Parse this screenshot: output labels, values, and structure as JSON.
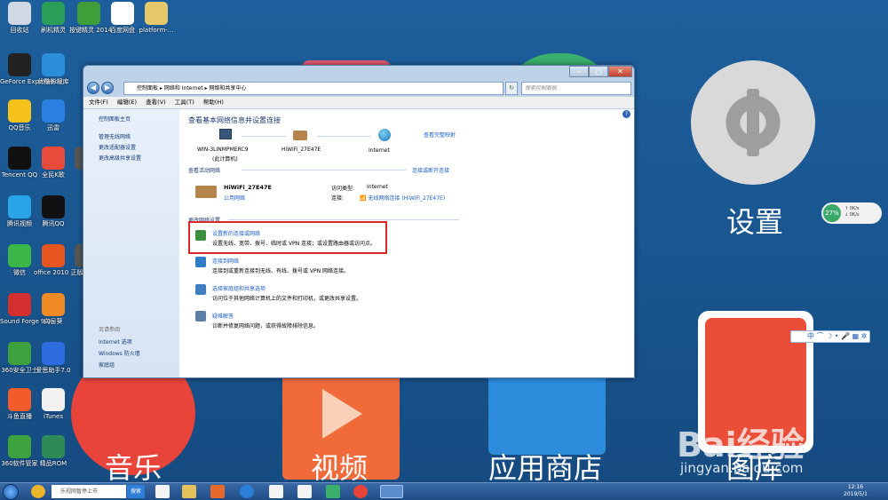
{
  "desktop": {
    "icons": [
      {
        "label": "回收站",
        "color": "#cfd8e3"
      },
      {
        "label": "刷机精灵",
        "color": "#2a9d59"
      },
      {
        "label": "按键精灵 2014",
        "color": "#3f9e3a"
      },
      {
        "label": "百度网盘",
        "color": "#ffffff"
      },
      {
        "label": "platform-...",
        "color": "#e6c86a"
      },
      {
        "label": "GeForce Experience",
        "color": "#222222"
      },
      {
        "label": "优酷影视库",
        "color": "#2a8ed8"
      },
      {
        "label": "QQ音乐",
        "color": "#f4c21b"
      },
      {
        "label": "迅雷",
        "color": "#2b7fe0"
      },
      {
        "label": "Tencent QQ",
        "color": "#111111"
      },
      {
        "label": "全民K歌",
        "color": "#e84b3c"
      },
      {
        "label": "ad",
        "color": "#555555"
      },
      {
        "label": "腾讯视频",
        "color": "#29a4e8"
      },
      {
        "label": "腾讯QQ",
        "color": "#111111"
      },
      {
        "label": "微信",
        "color": "#3bb749"
      },
      {
        "label": "office 2010 正版验证工",
        "color": "#e8561f"
      },
      {
        "label": "23-",
        "color": "#555555"
      },
      {
        "label": "Sound Forge 9.0a",
        "color": "#d43030"
      },
      {
        "label": "向日葵",
        "color": "#f08a24"
      },
      {
        "label": "360安全卫士",
        "color": "#3da23e"
      },
      {
        "label": "爱思助手7.0",
        "color": "#2e6de0"
      },
      {
        "label": "斗鱼直播",
        "color": "#f25b2a"
      },
      {
        "label": "iTunes",
        "color": "#f2f2f2"
      },
      {
        "label": "360软件管家",
        "color": "#3da23e"
      },
      {
        "label": "精品ROM",
        "color": "#2e8b57"
      }
    ],
    "tiles": {
      "settings_label": "设置",
      "music_label": "音乐",
      "video_label": "视频",
      "appstore_label": "应用商店",
      "gallery_label": "图库"
    },
    "net_widget": {
      "percent": "27%",
      "up": "0K/s",
      "down": "0K/s"
    },
    "ime_bar": {
      "text": "中 ⌒ ☽ • 🎤 ▦ ✲"
    },
    "watermark": {
      "logo": "Bai经验",
      "url": "jingyan.baidu.com"
    }
  },
  "window": {
    "nav": {
      "back": "◀",
      "forward": "▶"
    },
    "address": [
      "控制面板",
      "网络和 Internet",
      "网络和共享中心"
    ],
    "address_separator": " ▸ ",
    "refresh": "↻",
    "search_placeholder": "搜索控制面板",
    "menu": [
      "文件(F)",
      "编辑(E)",
      "查看(V)",
      "工具(T)",
      "帮助(H)"
    ],
    "help_icon": "?",
    "left_pane": {
      "home": "控制面板主页",
      "links": [
        "管理无线网络",
        "更改适配器设置",
        "更改高级共享设置"
      ],
      "see_also_title": "另请参阅",
      "see_also": [
        "Internet 选项",
        "Windows 防火墙",
        "家庭组"
      ]
    },
    "main": {
      "title": "查看基本网络信息并设置连接",
      "full_map": "查看完整映射",
      "map": {
        "computer_name": "WIN-3LINMPMERC9",
        "computer_sub": "(此计算机)",
        "network_name": "HiWiFi_27E47E",
        "internet": "Internet"
      },
      "active_networks_title": "查看活动网络",
      "connect_disconnect": "连接或断开连接",
      "active_network": {
        "name": "HiWiFi_27E47E",
        "type": "公用网络",
        "access_type_label": "访问类型:",
        "access_type_value": "Internet",
        "connections_label": "连接:",
        "connections_value": "无线网络连接 (HiWiFi_27E47E)"
      },
      "change_settings_title": "更改网络设置",
      "tasks": [
        {
          "title": "设置新的连接或网络",
          "desc": "设置无线、宽带、拨号、临时或 VPN 连接；或设置路由器或访问点。"
        },
        {
          "title": "连接到网络",
          "desc": "连接到或重新连接到无线、有线、拨号或 VPN 网络连接。"
        },
        {
          "title": "选择家庭组和共享选项",
          "desc": "访问位于其他网络计算机上的文件和打印机，或更改共享设置。"
        },
        {
          "title": "疑难解答",
          "desc": "诊断并修复网络问题，或获得故障排除信息。"
        }
      ]
    }
  },
  "taskbar": {
    "search_placeholder": "乐视网暂停上市",
    "search_button": "搜索",
    "time": "12:16",
    "date": "2019/5/1"
  }
}
